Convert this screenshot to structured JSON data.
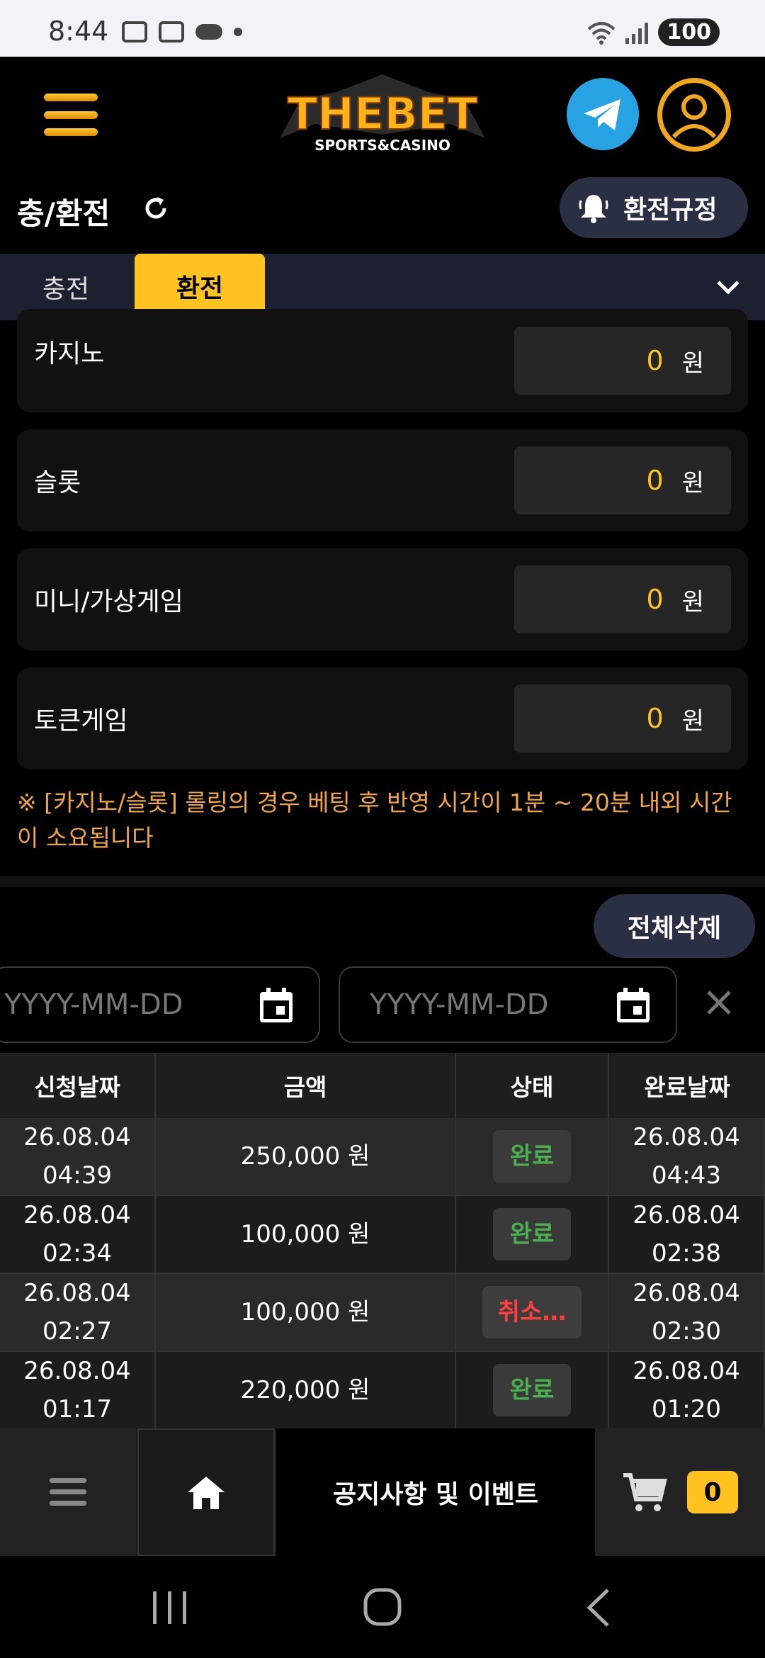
{
  "status_bar": {
    "time": "8:44",
    "battery": "100"
  },
  "header": {
    "logo_main": "THEBET",
    "logo_sub": "SPORTS&CASINO"
  },
  "sub_header": {
    "title": "충/환전",
    "rules_button": "환전규정"
  },
  "tabs": [
    {
      "label": "충전",
      "active": false
    },
    {
      "label": "환전",
      "active": true
    }
  ],
  "balances": [
    {
      "label": "카지노",
      "value": "0",
      "unit": "원"
    },
    {
      "label": "슬롯",
      "value": "0",
      "unit": "원"
    },
    {
      "label": "미니/가상게임",
      "value": "0",
      "unit": "원"
    },
    {
      "label": "토큰게임",
      "value": "0",
      "unit": "원"
    }
  ],
  "notice": "※ [카지노/슬롯] 롤링의 경우 베팅 후 반영 시간이 1분 ~ 20분 내외 시간이 소요됩니다",
  "delete_all": "전체삭제",
  "date_filter": {
    "start_placeholder": "YYYY-MM-DD",
    "end_placeholder": "YYYY-MM-DD"
  },
  "table": {
    "headers": [
      "신청날짜",
      "금액",
      "상태",
      "완료날짜"
    ],
    "rows": [
      {
        "req_date": "26.08.04",
        "req_time": "04:39",
        "amount": "250,000 원",
        "status": "완료",
        "done_date": "26.08.04",
        "done_time": "04:43"
      },
      {
        "req_date": "26.08.04",
        "req_time": "02:34",
        "amount": "100,000 원",
        "status": "완료",
        "done_date": "26.08.04",
        "done_time": "02:38"
      },
      {
        "req_date": "26.08.04",
        "req_time": "02:27",
        "amount": "100,000 원",
        "status": "취소…",
        "done_date": "26.08.04",
        "done_time": "02:30"
      },
      {
        "req_date": "26.08.04",
        "req_time": "01:17",
        "amount": "220,000 원",
        "status": "완료",
        "done_date": "26.08.04",
        "done_time": "01:20"
      }
    ]
  },
  "bottom_nav": {
    "notice_label": "공지사항 및 이벤트",
    "cart_count": "0"
  },
  "colors": {
    "accent": "#ffc31f",
    "done": "#4caf50",
    "cancel": "#ff4040",
    "notice": "#f2a640"
  }
}
